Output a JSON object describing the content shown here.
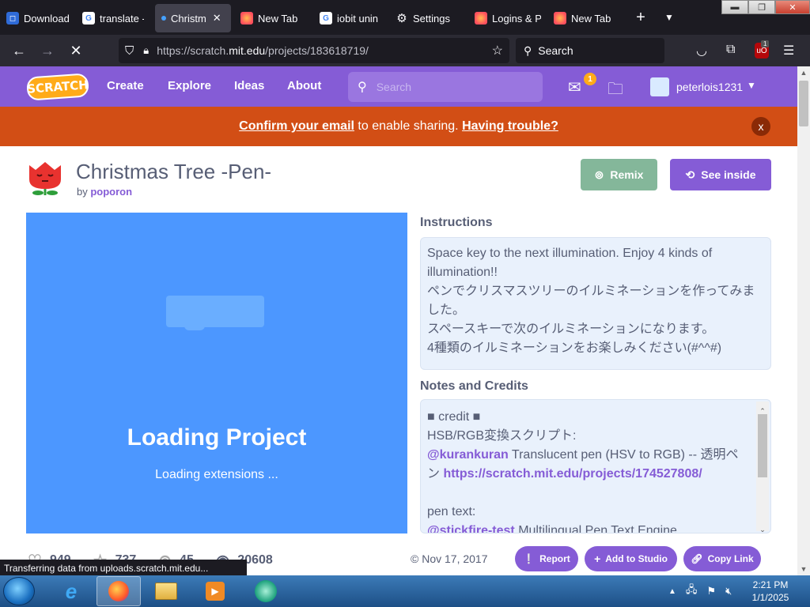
{
  "browser": {
    "tabs": [
      {
        "label": "Download",
        "icon": "dropbox-like-icon",
        "color": "#2f6bd8"
      },
      {
        "label": "translate -",
        "icon": "google-icon",
        "color": "#4285f4"
      },
      {
        "label": "Christm",
        "icon": "scratch-icon",
        "color": "#855cd6",
        "active": true
      },
      {
        "label": "New Tab",
        "icon": "firefox-icon",
        "color": "#ff7139"
      },
      {
        "label": "iobit unin",
        "icon": "google-icon",
        "color": "#4285f4"
      },
      {
        "label": "Settings",
        "icon": "gear-icon",
        "color": "#fbfbfe"
      },
      {
        "label": "Logins & P",
        "icon": "firefox-icon",
        "color": "#ff7139"
      },
      {
        "label": "New Tab",
        "icon": "firefox-icon",
        "color": "#ff7139"
      }
    ],
    "url_prefix": "https://scratch.",
    "url_domain": "mit.edu",
    "url_path": "/projects/183618719/",
    "search_placeholder": "Search",
    "ublock_badge": "1",
    "status_text": "Transferring data from uploads.scratch.mit.edu..."
  },
  "scratch": {
    "logo_text": "SCRATCH",
    "nav": {
      "create": "Create",
      "explore": "Explore",
      "ideas": "Ideas",
      "about": "About"
    },
    "search_placeholder": "Search",
    "message_count": "1",
    "username": "peterlois1231",
    "banner": {
      "confirm": "Confirm your email",
      "middle": " to enable sharing. ",
      "trouble": "Having trouble?",
      "close": "x"
    },
    "project": {
      "title": "Christmas Tree -Pen-",
      "by": "by ",
      "author": "poporon",
      "remix": "Remix",
      "see_inside": "See inside",
      "loading_title": "Loading Project",
      "loading_sub": "Loading extensions ..."
    },
    "instructions_heading": "Instructions",
    "instructions": [
      "Space key to the next illumination. Enjoy 4 kinds of",
      "illumination!!",
      "ペンでクリスマスツリーのイルミネーションを作ってみま",
      "した。",
      "スペースキーで次のイルミネーションになります。",
      "4種類のイルミネーションをお楽しみください(#^^#)"
    ],
    "notes_heading": "Notes and Credits",
    "notes": {
      "line1": "■ credit ■",
      "line2": "HSB/RGB変換スクリプト:",
      "mention1": "@kurankuran",
      "line3": " Translucent pen (HSV to RGB) -- 透明ペ",
      "line4a": "ン ",
      "link1": "https://scratch.mit.edu/projects/174527808/",
      "line5": "pen text:",
      "mention2": "@stickfire-test",
      "line6": " Multilingual Pen Text Engine"
    },
    "stats": {
      "loves": "949",
      "favorites": "737",
      "remixes": "45",
      "views": "20608"
    },
    "date": "Nov 17, 2017",
    "buttons": {
      "report": "Report",
      "add_to_studio": "Add to Studio",
      "copy_link": "Copy Link"
    }
  },
  "taskbar": {
    "time": "2:21 PM",
    "date": "1/1/2025"
  }
}
